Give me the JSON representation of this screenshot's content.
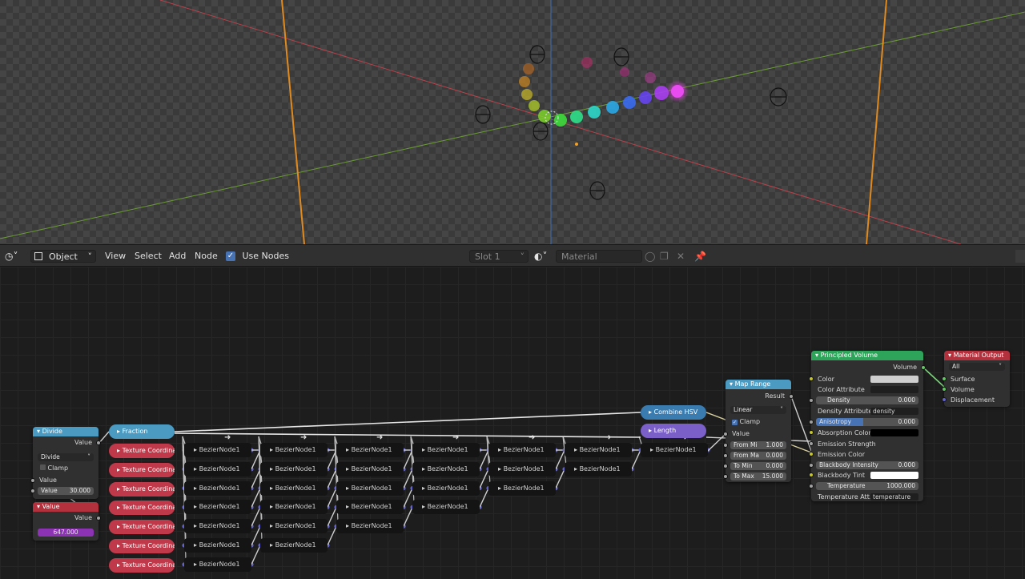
{
  "header": {
    "mode": "Object",
    "menus": [
      "View",
      "Select",
      "Add",
      "Node"
    ],
    "use_nodes_label": "Use Nodes",
    "slot": "Slot 1",
    "material_placeholder": "Material"
  },
  "nodes": {
    "divide": {
      "title": "Divide",
      "output": "Value",
      "operation": "Divide",
      "clamp_label": "Clamp",
      "input_label": "Value",
      "value_label": "Value",
      "value": "30.000"
    },
    "value": {
      "title": "Value",
      "output": "Value",
      "value": "647.000"
    },
    "fraction": {
      "title": "Fraction"
    },
    "texture_coordinate_label": "Texture Coordinate",
    "bezier_label": "BezierNode1",
    "combine_hsv": {
      "title": "Combine HSV"
    },
    "length": {
      "title": "Length"
    },
    "map_range": {
      "title": "Map Range",
      "output": "Result",
      "interpolation": "Linear",
      "clamp_label": "Clamp",
      "input_label": "Value",
      "fields": [
        {
          "label": "From Mi",
          "value": "1.000"
        },
        {
          "label": "From Ma",
          "value": "0.000"
        },
        {
          "label": "To Min",
          "value": "0.000"
        },
        {
          "label": "To Max",
          "value": "15.000"
        }
      ]
    },
    "principled_volume": {
      "title": "Principled Volume",
      "output": "Volume",
      "color_label": "Color",
      "color_attribute_label": "Color Attribute",
      "density_label": "Density",
      "density_value": "0.000",
      "density_attribute_label": "Density Attribute",
      "density_attribute_value": "density",
      "anisotropy_label": "Anisotropy",
      "anisotropy_value": "0.000",
      "absorption_color_label": "Absorption Color",
      "emission_strength_label": "Emission Strength",
      "emission_color_label": "Emission Color",
      "blackbody_intensity_label": "Blackbody Intensity",
      "blackbody_intensity_value": "0.000",
      "blackbody_tint_label": "Blackbody Tint",
      "temperature_label": "Temperature",
      "temperature_value": "1000.000",
      "temperature_attribute_label": "Temperature Att...",
      "temperature_attribute_value": "temperature"
    },
    "material_output": {
      "title": "Material Output",
      "target": "All",
      "surface_label": "Surface",
      "volume_label": "Volume",
      "displacement_label": "Displacement"
    }
  },
  "colors": {
    "header_input": "#4f8fc1",
    "header_converter": "#4a9ac2",
    "header_shader": "#2ea35a",
    "header_output": "#b3313d",
    "texture_coordinate": "#c0394a",
    "combine_hsv": "#3a7bb0",
    "length": "#7b5fc9",
    "value_swatch": "#8c33b3"
  }
}
